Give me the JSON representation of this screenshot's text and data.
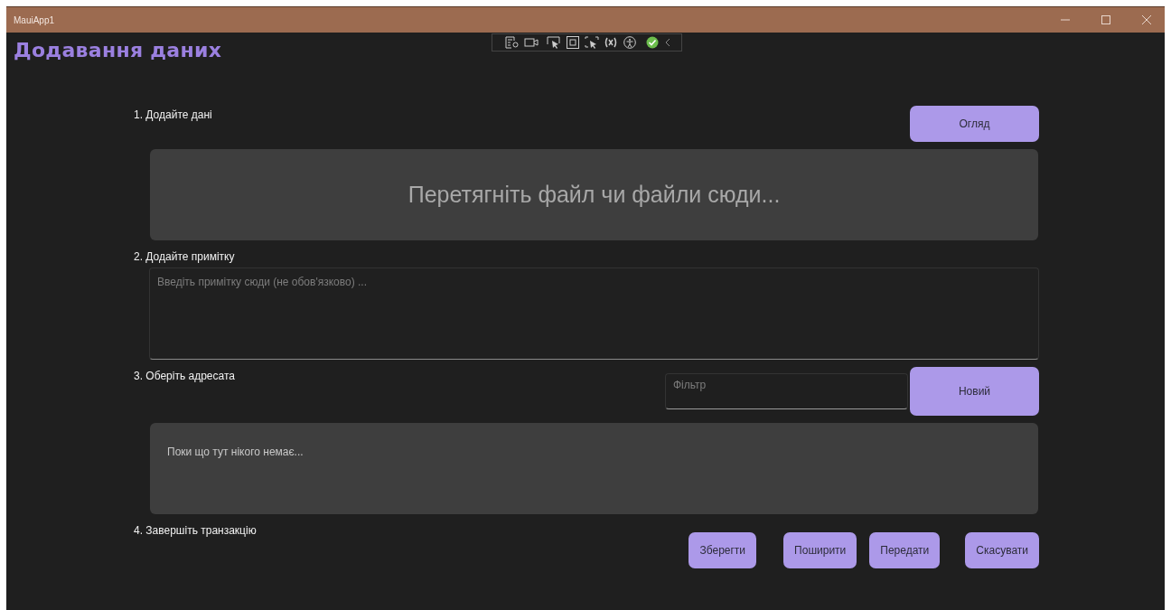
{
  "window": {
    "title": "MauiApp1"
  },
  "heading": "Додавання даних",
  "step_1": {
    "label": "1. Додайте дані",
    "button": "Огляд",
    "drop_zone": "Перетягніть файл чи файли сюди..."
  },
  "step_2": {
    "label": "2. Додайте примітку",
    "note_field": {
      "placeholder": "Введіть примітку сюди (не обов'язково) ..."
    }
  },
  "step_3": {
    "label": "3. Оберіть адресата",
    "filter_field": {
      "placeholder": "Фільтр"
    },
    "button": "Новий",
    "recipients_list": {
      "empty_text": "Поки що тут нікого немає..."
    }
  },
  "step_4": {
    "label": "4. Завершіть транзакцію",
    "buttons": [
      "Зберегти",
      "Поширити",
      "Передати",
      "Скасувати"
    ]
  }
}
